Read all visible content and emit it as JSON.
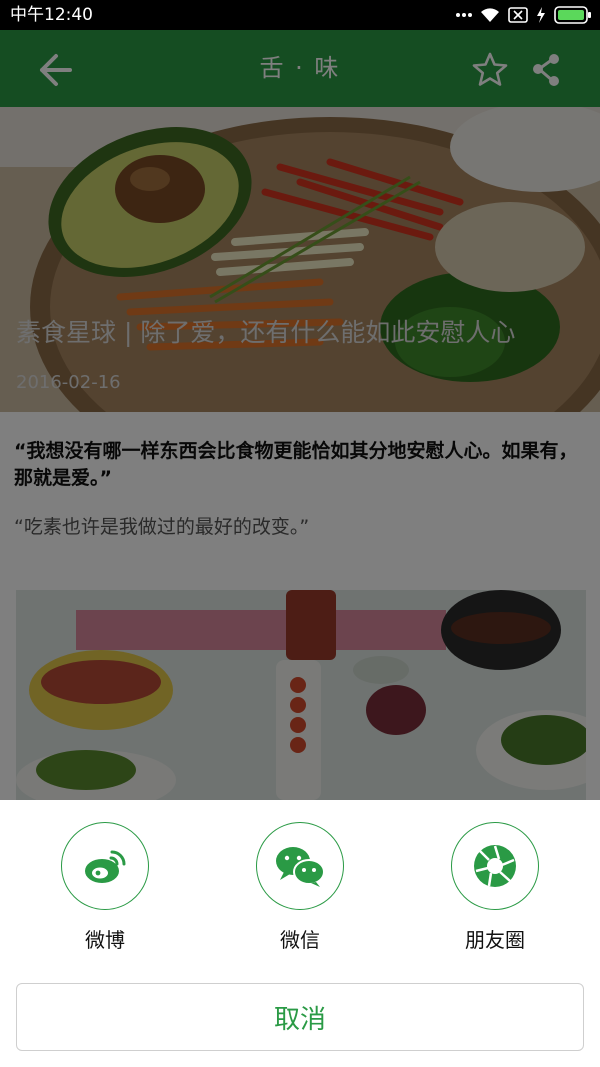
{
  "status_bar": {
    "time": "中午12:40"
  },
  "app_bar": {
    "title": "舌 · 味"
  },
  "article": {
    "title": "素食星球 | 除了爱，还有什么能如此安慰人心",
    "date": "2016-02-16",
    "quote_1": "“我想没有哪一样东西会比食物更能恰如其分地安慰人心。如果有，那就是爱。”",
    "quote_2": "“吃素也许是我做过的最好的改变。”"
  },
  "share_sheet": {
    "options": [
      {
        "label": "微博",
        "icon": "weibo-icon"
      },
      {
        "label": "微信",
        "icon": "wechat-icon"
      },
      {
        "label": "朋友圈",
        "icon": "moments-icon"
      }
    ],
    "cancel_label": "取消"
  },
  "colors": {
    "brand_green": "#2a9a45",
    "overlay": "rgba(0,0,0,0.5)"
  }
}
